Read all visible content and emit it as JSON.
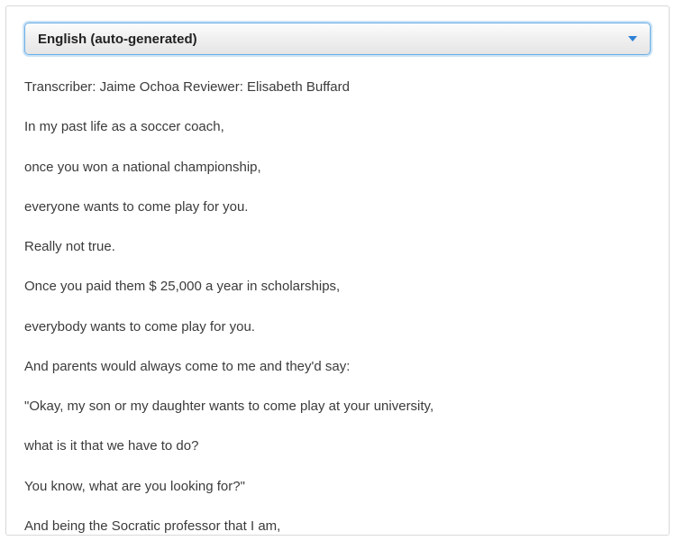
{
  "dropdown": {
    "selected": "English (auto-generated)"
  },
  "transcript": {
    "lines": [
      "Transcriber: Jaime Ochoa Reviewer: Elisabeth Buffard",
      "In my past life as a soccer coach,",
      "once you won a national championship,",
      "everyone wants to come play for you.",
      "Really not true.",
      "Once you paid them $ 25,000 a year in scholarships,",
      "everybody wants to come play for you.",
      "And parents would always come to me and they'd say:",
      "\"Okay, my son or my daughter wants to come play at your university,",
      "what is it that we have to do?",
      "You know, what are you looking for?\"",
      "And being the Socratic professor that I am,"
    ]
  }
}
